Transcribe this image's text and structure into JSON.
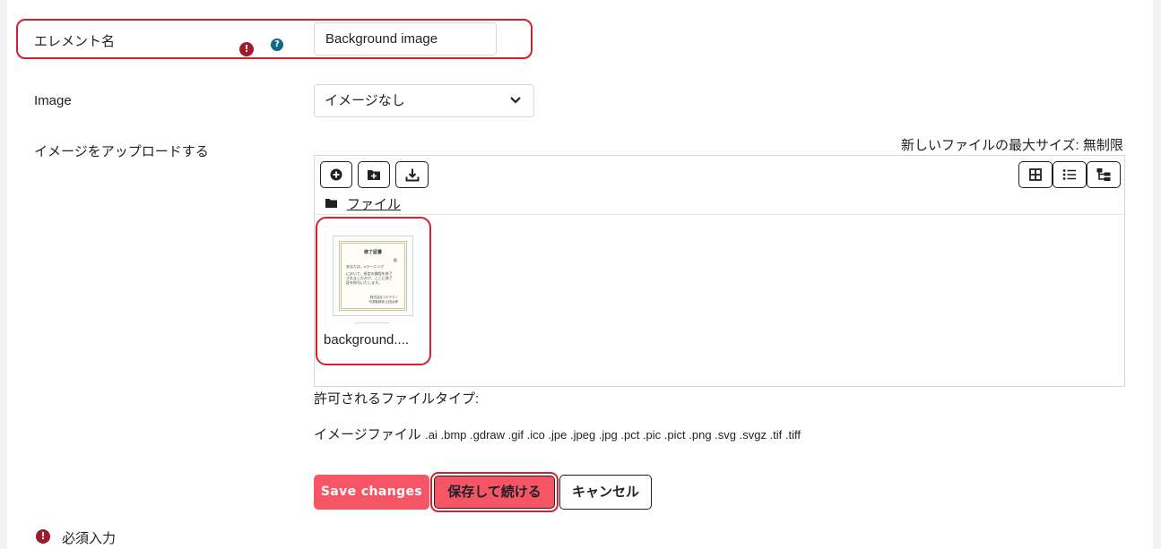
{
  "form": {
    "element_name": {
      "label": "エレメント名",
      "value": "Background image",
      "required_icon": "!",
      "help_icon": "?"
    },
    "image": {
      "label": "Image",
      "selected": "イメージなし"
    },
    "upload": {
      "label": "イメージをアップロードする",
      "max_size": "新しいファイルの最大サイズ: 無制限",
      "folder_path": "ファイル",
      "files": [
        {
          "name": "background....",
          "thumb_lines": [
            "修了証書",
            "殿",
            "あなたは、eラーニング",
            "において、所定の課程を修了",
            "されましたので、ここに修了",
            "証を授与いたします。",
            "株式会社コナテクノ",
            "代表取締役 山田太郎"
          ]
        }
      ],
      "allowed_label": "許可されるファイルタイプ:",
      "allowed_group": "イメージファイル",
      "allowed_exts": ".ai .bmp .gdraw .gif .ico .jpe .jpeg .jpg .pct .pic .pict .png .svg .svgz .tif .tiff"
    },
    "buttons": {
      "save": "Save changes",
      "save_continue": "保存して続ける",
      "cancel": "キャンセル"
    },
    "required_note": "必須入力"
  },
  "icons": {
    "toolbar_left": [
      "plus-circle-icon",
      "add-folder-icon",
      "download-icon"
    ],
    "toolbar_right": [
      "grid-view-icon",
      "list-view-icon",
      "tree-view-icon"
    ],
    "breadcrumb": "folder-icon",
    "select": "chevron-down-icon"
  },
  "colors": {
    "highlight": "#d0212f",
    "primary": "#f55565",
    "required": "#a11a2b",
    "help": "#0f6a86"
  }
}
